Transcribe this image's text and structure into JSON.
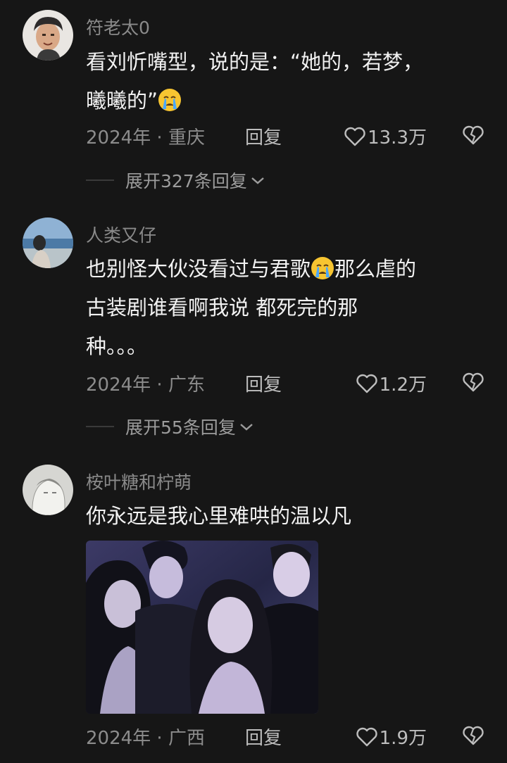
{
  "comments": [
    {
      "username": "符老太0",
      "text_before": "看刘忻嘴型，说的是：“她的，若梦，",
      "text_line2": "曦曦的”",
      "time_location": "2024年 · 重庆",
      "reply_label": "回复",
      "likes": "13.3万",
      "expand_label": "展开327条回复"
    },
    {
      "username": "人类又仔",
      "text_part1": "也别怪大伙没看过与君歌",
      "text_part2": "那么虐的",
      "text_line2": "古装剧谁看啊我说 都死完的那",
      "text_line3": "种。。。",
      "time_location": "2024年 · 广东",
      "reply_label": "回复",
      "likes": "1.2万",
      "expand_label": "展开55条回复"
    },
    {
      "username": "桉叶糖和柠萌",
      "text": "你永远是我心里难哄的温以凡",
      "time_location": "2024年 · 广西",
      "reply_label": "回复",
      "likes": "1.9万"
    }
  ],
  "icons": {
    "like": "heart-outline-icon",
    "dislike": "broken-heart-icon",
    "expand": "chevron-down-icon",
    "emoji": "crying-face-emoji"
  },
  "colors": {
    "background": "#161616",
    "username": "#8a8a8a",
    "text": "#f2f2f2",
    "meta": "#8c8c8c"
  }
}
